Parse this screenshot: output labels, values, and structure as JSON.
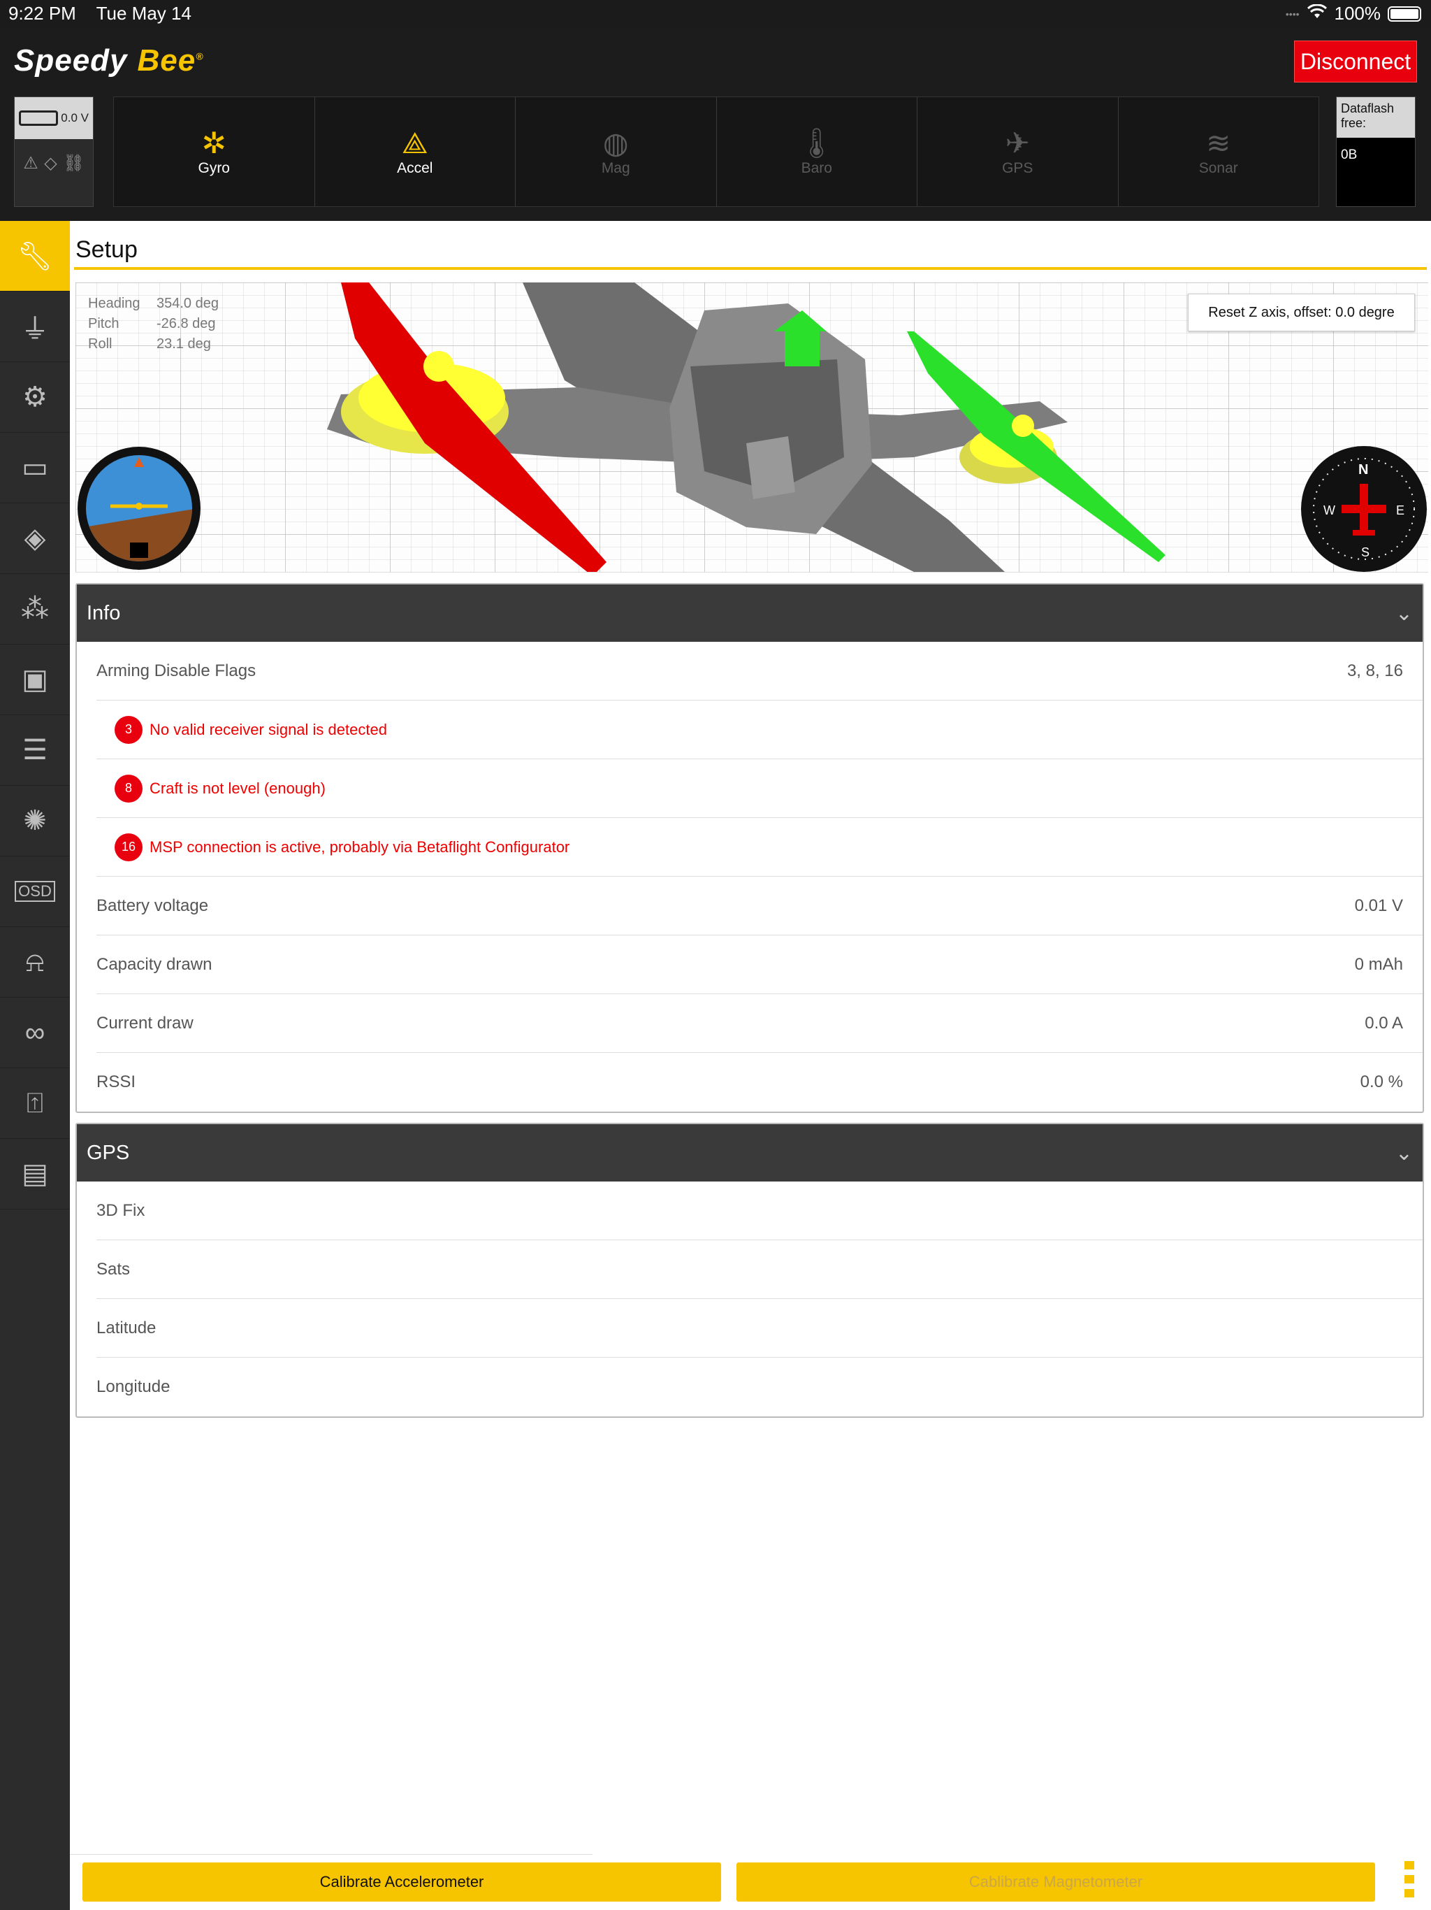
{
  "status_bar": {
    "time": "9:22 PM",
    "date": "Tue May 14",
    "battery": "100%"
  },
  "header": {
    "logo_part1": "Speedy",
    "logo_part2": "Bee",
    "disconnect_label": "Disconnect",
    "battery_voltage": "0.0 V",
    "dataflash_label": "Dataflash free:",
    "dataflash_value": "0B"
  },
  "sensors": [
    {
      "label": "Gyro",
      "icon": "gyro-icon",
      "active": true
    },
    {
      "label": "Accel",
      "icon": "accel-icon",
      "active": true
    },
    {
      "label": "Mag",
      "icon": "mag-icon",
      "active": false
    },
    {
      "label": "Baro",
      "icon": "baro-icon",
      "active": false
    },
    {
      "label": "GPS",
      "icon": "gps-icon",
      "active": false
    },
    {
      "label": "Sonar",
      "icon": "sonar-icon",
      "active": false
    }
  ],
  "sidebar": {
    "items": [
      {
        "icon": "wrench-icon",
        "active": true
      },
      {
        "icon": "plug-icon"
      },
      {
        "icon": "gear-icon"
      },
      {
        "icon": "battery-icon"
      },
      {
        "icon": "failsafe-icon"
      },
      {
        "icon": "mixer-icon"
      },
      {
        "icon": "receiver-icon"
      },
      {
        "icon": "modes-icon"
      },
      {
        "icon": "motors-icon"
      },
      {
        "icon": "osd-icon"
      },
      {
        "icon": "led-icon"
      },
      {
        "icon": "blackbox-icon"
      },
      {
        "icon": "vtx-icon"
      },
      {
        "icon": "cli-icon"
      }
    ]
  },
  "main": {
    "title": "Setup",
    "attitude": {
      "heading_label": "Heading",
      "heading_value": "354.0 deg",
      "pitch_label": "Pitch",
      "pitch_value": "-26.8 deg",
      "roll_label": "Roll",
      "roll_value": "23.1 deg"
    },
    "reset_z_label": "Reset Z axis, offset: 0.0 degre",
    "info": {
      "title": "Info",
      "arming_label": "Arming Disable Flags",
      "arming_value": "3, 8, 16",
      "flags": [
        {
          "num": "3",
          "text": "No valid receiver signal is detected"
        },
        {
          "num": "8",
          "text": "Craft is not level (enough)"
        },
        {
          "num": "16",
          "text": "MSP connection is active, probably via Betaflight Configurator"
        }
      ],
      "rows": [
        {
          "label": "Battery voltage",
          "value": "0.01 V"
        },
        {
          "label": "Capacity drawn",
          "value": "0 mAh"
        },
        {
          "label": "Current draw",
          "value": "0.0 A"
        },
        {
          "label": "RSSI",
          "value": "0.0 %"
        }
      ]
    },
    "gps": {
      "title": "GPS",
      "rows": [
        {
          "label": "3D Fix",
          "value": ""
        },
        {
          "label": "Sats",
          "value": ""
        },
        {
          "label": "Latitude",
          "value": ""
        },
        {
          "label": "Longitude",
          "value": ""
        }
      ]
    },
    "buttons": {
      "calibrate_acc": "Calibrate Accelerometer",
      "calibrate_mag": "Cablibrate Magnetometer"
    }
  },
  "colors": {
    "accent": "#f7c400",
    "danger": "#e8000f",
    "header": "#1c1c1c",
    "sidebar": "#2c2c2c"
  }
}
